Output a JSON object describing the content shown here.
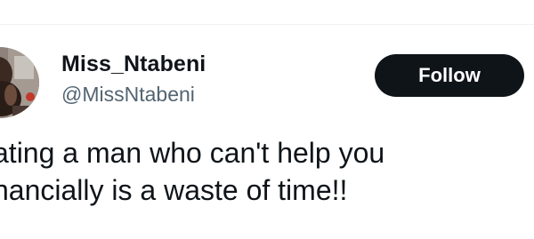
{
  "author": {
    "display_name": "Miss_Ntabeni",
    "handle": "@MissNtabeni"
  },
  "actions": {
    "follow_label": "Follow"
  },
  "tweet": {
    "lines": [
      "ating a man who can't help you",
      "nancially is a waste of time!!"
    ]
  },
  "colors": {
    "text_primary": "#0f1419",
    "text_secondary": "#536471",
    "button_bg": "#0f1419",
    "divider": "#eff3f4"
  },
  "icons": {
    "avatar": "profile-photo"
  }
}
